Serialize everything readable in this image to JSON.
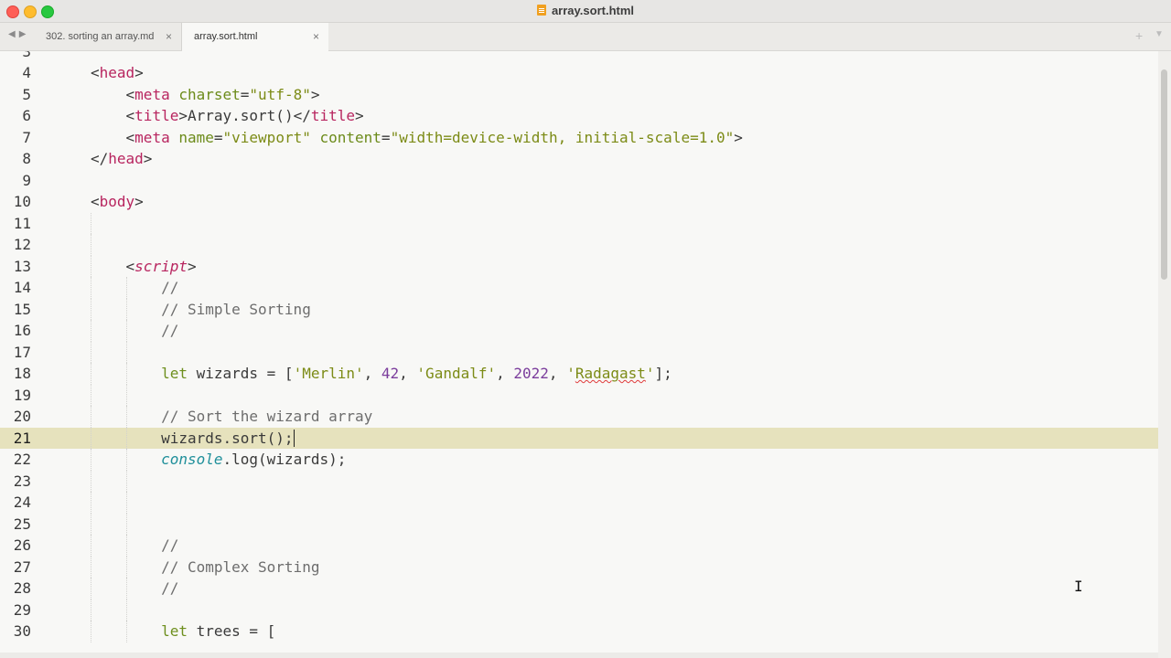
{
  "window": {
    "title": "array.sort.html"
  },
  "tabs": [
    {
      "label": "302. sorting an array.md",
      "active": false
    },
    {
      "label": "array.sort.html",
      "active": true
    }
  ],
  "editor": {
    "active_line": 21,
    "lines": [
      {
        "n": "3",
        "code": ""
      },
      {
        "n": "4",
        "code": "<head>"
      },
      {
        "n": "5",
        "code": "    <meta charset=\"utf-8\">"
      },
      {
        "n": "6",
        "code": "    <title>Array.sort()</title>"
      },
      {
        "n": "7",
        "code": "    <meta name=\"viewport\" content=\"width=device-width, initial-scale=1.0\">"
      },
      {
        "n": "8",
        "code": "</head>"
      },
      {
        "n": "9",
        "code": ""
      },
      {
        "n": "10",
        "code": "<body>"
      },
      {
        "n": "11",
        "code": ""
      },
      {
        "n": "12",
        "code": ""
      },
      {
        "n": "13",
        "code": "    <script>"
      },
      {
        "n": "14",
        "code": "        //"
      },
      {
        "n": "15",
        "code": "        // Simple Sorting"
      },
      {
        "n": "16",
        "code": "        //"
      },
      {
        "n": "17",
        "code": ""
      },
      {
        "n": "18",
        "code": "        let wizards = ['Merlin', 42, 'Gandalf', 2022, 'Radagast'];"
      },
      {
        "n": "19",
        "code": ""
      },
      {
        "n": "20",
        "code": "        // Sort the wizard array"
      },
      {
        "n": "21",
        "code": "        wizards.sort();"
      },
      {
        "n": "22",
        "code": "        console.log(wizards);"
      },
      {
        "n": "23",
        "code": ""
      },
      {
        "n": "24",
        "code": ""
      },
      {
        "n": "25",
        "code": ""
      },
      {
        "n": "26",
        "code": "        //"
      },
      {
        "n": "27",
        "code": "        // Complex Sorting"
      },
      {
        "n": "28",
        "code": "        //"
      },
      {
        "n": "29",
        "code": ""
      },
      {
        "n": "30",
        "code": "        let trees = ["
      }
    ]
  },
  "colors": {
    "tag": "#b8255f",
    "attr": "#6c8b1a",
    "string": "#7c8b16",
    "comment": "#6d6d6d",
    "number": "#7b3d9c",
    "object": "#1f8f9a",
    "active_line_bg": "#e6e2bd"
  },
  "icons": {
    "back": "chevron-left-icon",
    "forward": "chevron-right-icon",
    "new_tab": "plus-icon",
    "tab_menu": "chevron-down-icon",
    "close_tab": "close-icon",
    "file": "html-file-icon",
    "cursor": "ibeam-cursor-icon"
  }
}
